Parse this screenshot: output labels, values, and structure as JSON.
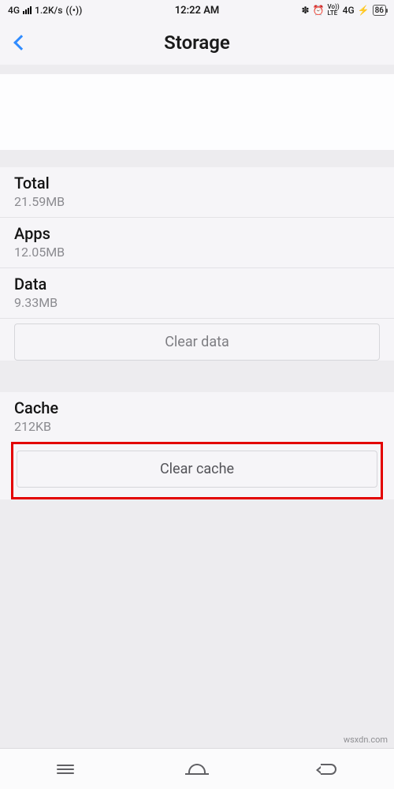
{
  "status": {
    "network_label": "4G",
    "speed": "1.2K/s",
    "time": "12:22 AM",
    "volte": "Vo))\nLTE",
    "net_gen": "4G",
    "battery": "86"
  },
  "header": {
    "title": "Storage"
  },
  "storage": {
    "total": {
      "label": "Total",
      "value": "21.59MB"
    },
    "apps": {
      "label": "Apps",
      "value": "12.05MB"
    },
    "data": {
      "label": "Data",
      "value": "9.33MB"
    },
    "clear_data_label": "Clear data"
  },
  "cache": {
    "label": "Cache",
    "value": "212KB",
    "clear_cache_label": "Clear cache"
  },
  "watermark": "wsxdn.com"
}
